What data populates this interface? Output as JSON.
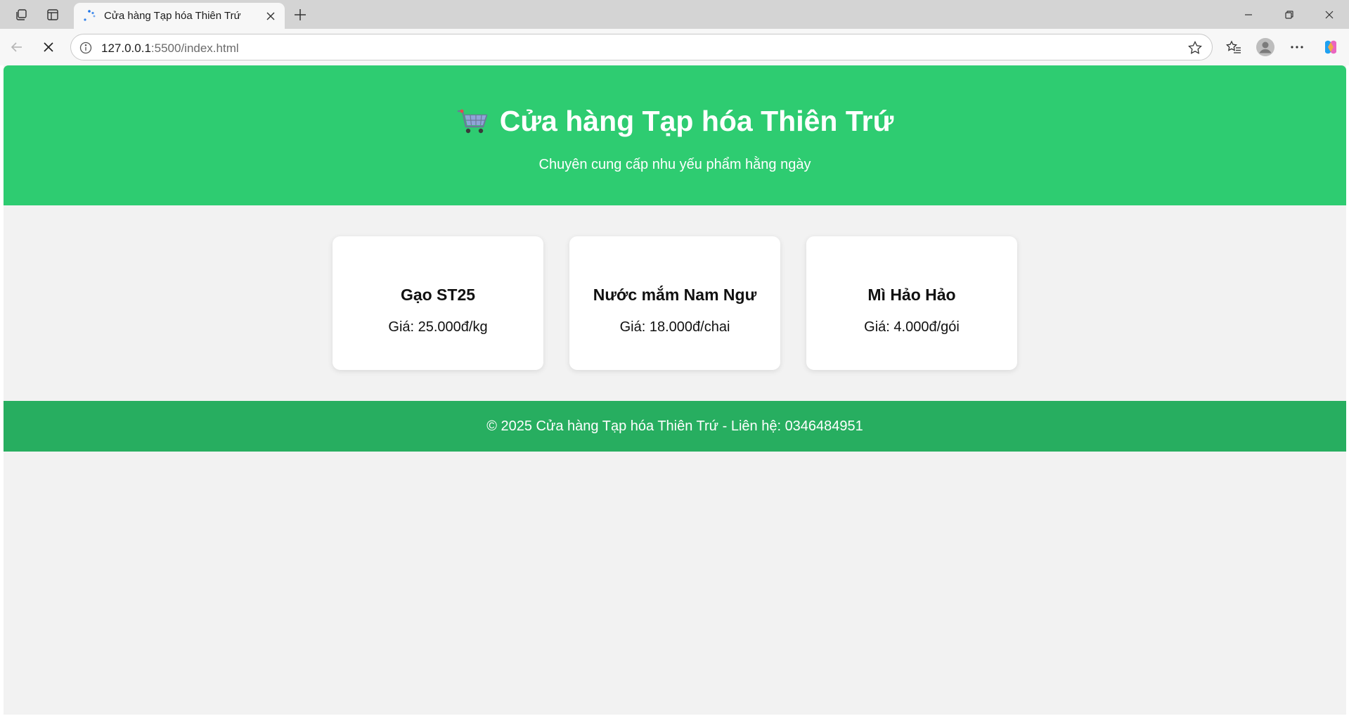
{
  "browser": {
    "tab_title": "Cửa hàng Tạp hóa Thiên Trứ",
    "url_host": "127.0.0.1",
    "url_path": ":5500/index.html"
  },
  "header": {
    "title": "Cửa hàng Tạp hóa Thiên Trứ",
    "subtitle": "Chuyên cung cấp nhu yếu phẩm hằng ngày",
    "icon": "shopping-cart-icon"
  },
  "products": [
    {
      "name": "Gạo ST25",
      "price": "Giá: 25.000đ/kg"
    },
    {
      "name": "Nước mắm Nam Ngư",
      "price": "Giá: 18.000đ/chai"
    },
    {
      "name": "Mì Hảo Hảo",
      "price": "Giá: 4.000đ/gói"
    }
  ],
  "footer": {
    "text": "© 2025 Cửa hàng Tạp hóa Thiên Trứ - Liên hệ: 0346484951"
  },
  "colors": {
    "header_bg": "#2ecc71",
    "footer_bg": "#27ae60",
    "page_bg": "#f2f2f2"
  }
}
